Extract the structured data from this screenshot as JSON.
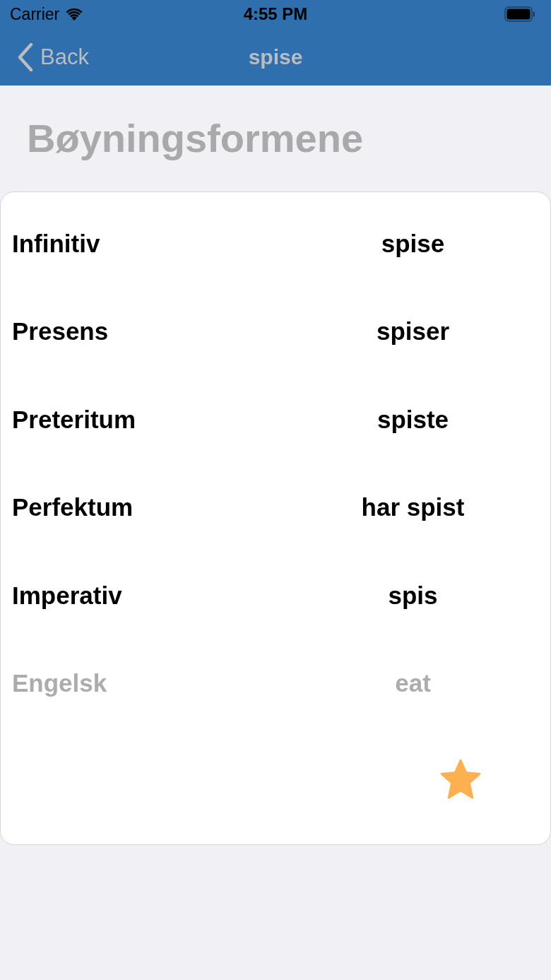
{
  "status_bar": {
    "carrier": "Carrier",
    "time": "4:55 PM"
  },
  "nav_bar": {
    "back": "Back",
    "title": "spise"
  },
  "heading": "Bøyningsformene",
  "rows": [
    {
      "kind": "form",
      "label": "Infinitiv",
      "value": "spise"
    },
    {
      "kind": "form",
      "label": "Presens",
      "value": "spiser"
    },
    {
      "kind": "form",
      "label": "Preteritum",
      "value": "spiste"
    },
    {
      "kind": "form",
      "label": "Perfektum",
      "value": "har spist"
    },
    {
      "kind": "form",
      "label": "Imperativ",
      "value": "spis"
    },
    {
      "kind": "translation",
      "label": "Engelsk",
      "value": "eat"
    }
  ],
  "favorite": {
    "selected": true
  }
}
